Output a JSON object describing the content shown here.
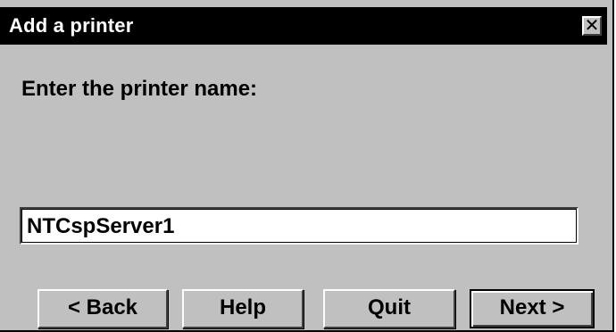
{
  "window": {
    "title": "Add a printer",
    "close_glyph": "✕",
    "close_icon": "close-icon"
  },
  "content": {
    "prompt": "Enter the printer name:",
    "printer_name": {
      "value": "NTCspServer1",
      "placeholder": ""
    }
  },
  "buttons": {
    "back": "< Back",
    "help": "Help",
    "quit": "Quit",
    "next": "Next >"
  },
  "colors": {
    "dialog_background": "#c0c0c0",
    "titlebar_background": "#000000",
    "titlebar_text": "#ffffff",
    "input_background": "#ffffff"
  }
}
